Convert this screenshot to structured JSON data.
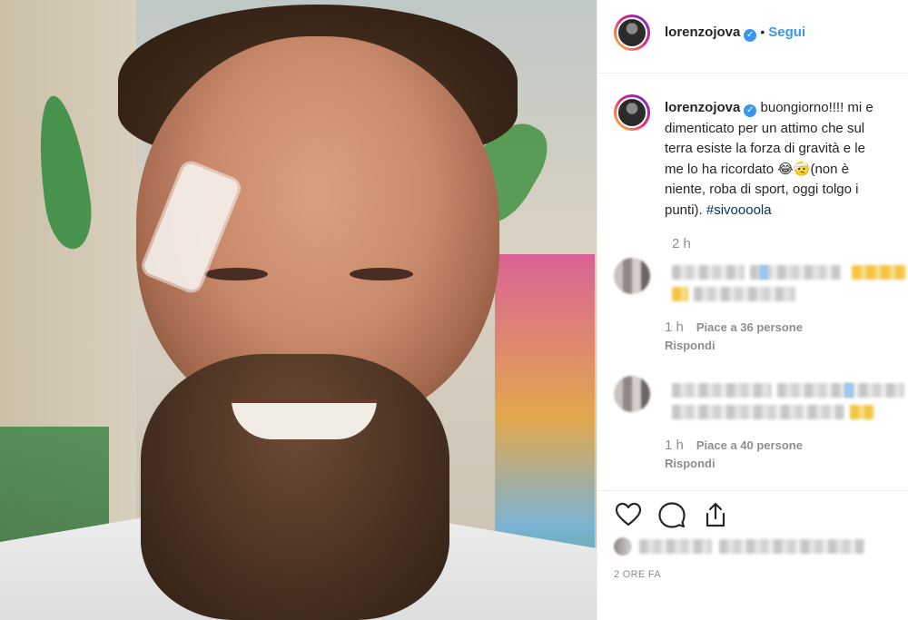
{
  "post": {
    "username": "lorenzojova",
    "follow_label": "Segui",
    "caption_lines": [
      "buongiorno!!!! mi e",
      "dimenticato per un attimo che sul",
      "terra esiste la forza di gravità e le",
      "me lo ha ricordato",
      "niente, roba di sport, oggi tolgo i",
      "punti)."
    ],
    "caption_emoji": "😂🤕",
    "caption_after_emoji": "(non è",
    "hashtag": "#sivoooola",
    "caption_time": "2 h",
    "posted_ago": "2 ORE FA"
  },
  "comments": [
    {
      "time": "1 h",
      "likes": "Piace a 36 persone",
      "reply_label": "Rispondi"
    },
    {
      "time": "1 h",
      "likes": "Piace a 40 persone",
      "reply_label": "Rispondi"
    }
  ],
  "icons": {
    "verified": "verified-badge-icon",
    "like": "heart-icon",
    "comment": "comment-bubble-icon",
    "share": "share-icon"
  },
  "colors": {
    "accent": "#3897f0",
    "hashtag": "#003569",
    "muted": "#8e8e8e",
    "text": "#262626"
  }
}
